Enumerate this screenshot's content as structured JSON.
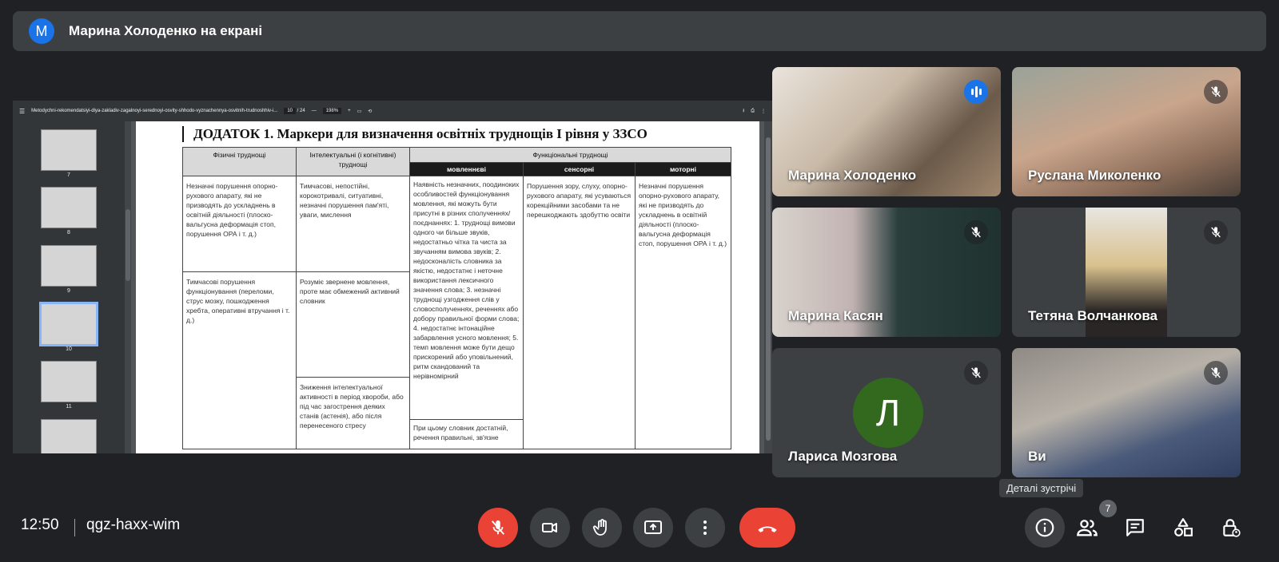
{
  "banner": {
    "avatar_letter": "M",
    "title": "Марина Холоденко на екрані"
  },
  "pdf": {
    "filename": "Metodychni-rekomendatsiyi-dlya-zakladiv-zagalnoyi-serednoyi-osvity-shhodo-vyznachennya-osvitnih-trudnoshhiv-i...",
    "page_current": "10",
    "page_sep": "/",
    "page_total": "24",
    "zoom": "198%",
    "thumb_numbers": [
      "7",
      "8",
      "9",
      "10",
      "11"
    ],
    "doc_title": "ДОДАТОК 1.  Маркери  для визначення освітніх труднощів І рівня у ЗЗСО",
    "table": {
      "h_physical": "Фізичні труднощі",
      "h_intellect": "Інтелектуальні (і когнітивні) труднощі",
      "h_functional": "Функціональні труднощі",
      "h_speech": "мовленнєві",
      "h_sensory": "сенсорні",
      "h_motor": "моторні",
      "r1_physical": "Незначні порушення опорно-рухового апарату, які не призводять до ускладнень в освітній діяльності (плоско-вальгусна деформація стоп, порушення ОРА і т. д.)",
      "r1_intellect": "Тимчасові, непостійні, корокотривалі, ситуативні, незначні порушення пам'яті, уваги, мислення",
      "speech_text": "Наявність незначних, поодиноких особливостей функціонування мовлення, які можуть бути присутні в різних сполученнях/поєднаннях: 1. труднощі вимови одного чи більше звуків, недостатньо чітка та чиста за звучанням вимова звуків; 2. недосконалість словника за якістю, недостатнє і неточне використання лексичного значення слова; 3. незначні труднощі узгодження слів у словосполученнях, реченнях або добору правильної форми слова; 4. недостатнє інтонаційне забарвлення усного мовлення; 5. темп мовлення може бути дещо прискорений або уповільнений, ритм скандований та нерівномірний",
      "speech_text2": "При цьому словник достатній, речення правильні, зв'язне",
      "sensory_text": "Порушення зору, слуху, опорно-рухового апарату, які усуваються корекційними засобами та не перешкоджають здобуттю освіти",
      "motor_text": "Незначні порушення опорно-рухового апарату, які не призводять до ускладнень в освітній діяльності (плоско-вальгусна деформація стоп, порушення ОРА і т. д.)",
      "r2_physical": "Тимчасові порушення функціонування (переломи, струс мозку, пошкодження хребта, оперативні втручання і т. д.)",
      "r2_intellect": "Розуміє звернене мовлення, проте має обмежений активний словник",
      "r3_intellect": "Зниження інтелектуальної активності в період хвороби, або під час загострення деяких станів (астенія), або після перенесеного стресу"
    }
  },
  "participants": [
    {
      "name": "Марина Холоденко",
      "state": "speaking"
    },
    {
      "name": "Руслана Миколенко",
      "state": "muted"
    },
    {
      "name": "Марина Касян",
      "state": "muted"
    },
    {
      "name": "Тетяна Волчанкова",
      "state": "muted"
    },
    {
      "name": "Лариса Мозгова",
      "state": "muted",
      "avatar_letter": "Л"
    },
    {
      "name": "Ви",
      "state": "muted"
    }
  ],
  "bottom": {
    "time": "12:50",
    "meeting_code": "qgz-haxx-wim",
    "tooltip": "Деталі зустрічі",
    "people_count": "7"
  },
  "colors": {
    "accent": "#8ab4f8",
    "danger": "#ea4335",
    "bg": "#202124",
    "tile": "#3c4043"
  }
}
